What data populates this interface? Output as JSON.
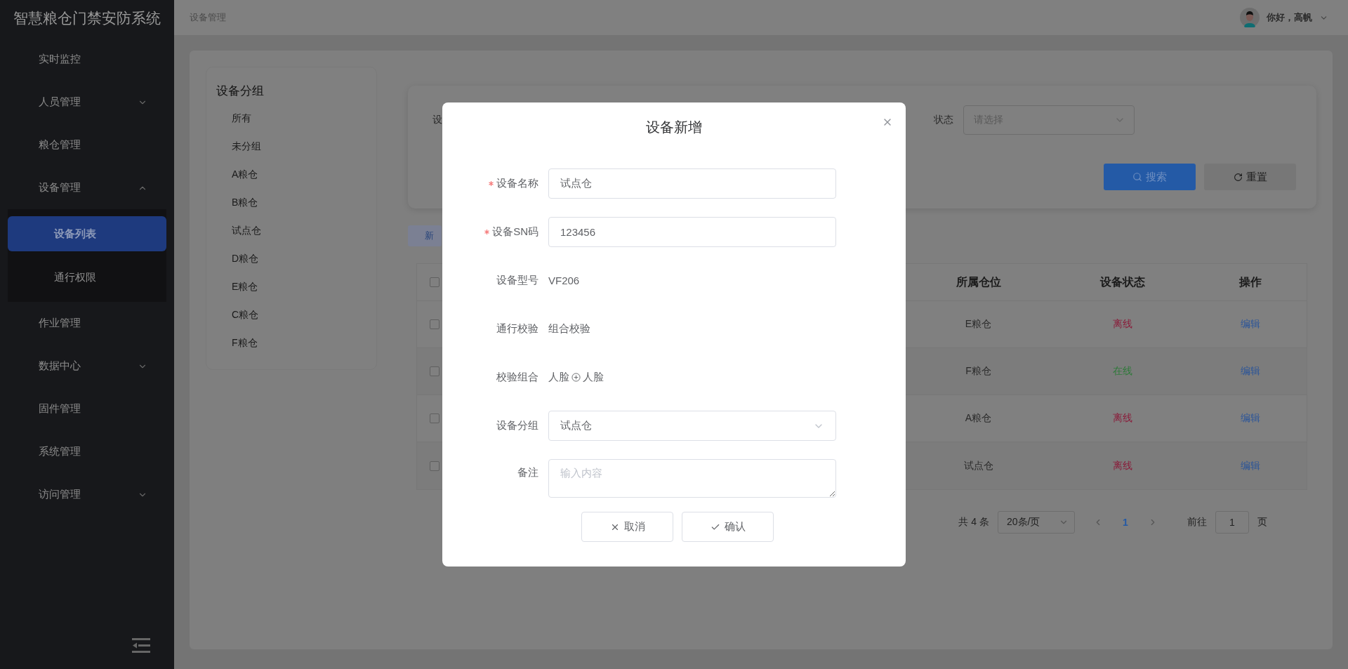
{
  "app_title": "智慧粮仓门禁安防系统",
  "sidebar": {
    "items": [
      {
        "kind": "link",
        "label": "实时监控",
        "selected": false
      },
      {
        "kind": "group",
        "label": "人员管理",
        "selected": false,
        "expanded": false
      },
      {
        "kind": "link",
        "label": "粮仓管理",
        "selected": false
      },
      {
        "kind": "group",
        "label": "设备管理",
        "selected": false,
        "expanded": true,
        "children": [
          {
            "label": "设备列表",
            "selected": true
          },
          {
            "label": "通行权限",
            "selected": false
          }
        ]
      },
      {
        "kind": "link",
        "label": "作业管理",
        "selected": false
      },
      {
        "kind": "group",
        "label": "数据中心",
        "selected": false,
        "expanded": false
      },
      {
        "kind": "link",
        "label": "固件管理",
        "selected": false
      },
      {
        "kind": "link",
        "label": "系统管理",
        "selected": false
      },
      {
        "kind": "group",
        "label": "访问管理",
        "selected": false,
        "expanded": false
      }
    ]
  },
  "header": {
    "breadcrumb": "设备管理",
    "greeting": "你好，高帆"
  },
  "group_panel": {
    "title": "设备分组",
    "items": [
      "所有",
      "未分组",
      "A粮仓",
      "B粮仓",
      "试点仓",
      "D粮仓",
      "E粮仓",
      "C粮仓",
      "F粮仓"
    ]
  },
  "filter": {
    "fields": [
      {
        "label": "设"
      },
      {
        "label": "状态",
        "placeholder": "请选择"
      }
    ],
    "buttons": [
      {
        "kind": "primary",
        "label": "搜索"
      },
      {
        "kind": "default",
        "label": "重置"
      }
    ]
  },
  "toolbar": {
    "add_button": "新"
  },
  "table": {
    "header_checked": false,
    "columns": [
      "所属仓位",
      "设备状态",
      "操作"
    ],
    "rows": [
      {
        "checked": false,
        "location": "E粮仓",
        "status": "离线",
        "online": false,
        "action": "编辑"
      },
      {
        "checked": false,
        "location": "F粮仓",
        "status": "在线",
        "online": true,
        "action": "编辑"
      },
      {
        "checked": false,
        "location": "A粮仓",
        "status": "离线",
        "online": false,
        "action": "编辑"
      },
      {
        "checked": false,
        "location": "试点仓",
        "status": "离线",
        "online": false,
        "action": "编辑"
      }
    ]
  },
  "pagination": {
    "total": "共 4 条",
    "page_size": "20条/页",
    "pages": [
      {
        "label": "1",
        "selected": true
      }
    ],
    "goto_label": "前往",
    "goto_value": "1",
    "goto_suffix": "页"
  },
  "dialog": {
    "title": "设备新增",
    "fields": [
      {
        "kind": "input",
        "label": "设备名称",
        "required": true,
        "value": "试点仓"
      },
      {
        "kind": "input",
        "label": "设备SN码",
        "required": true,
        "value": "123456"
      },
      {
        "kind": "text",
        "label": "设备型号",
        "required": false,
        "value": "VF206"
      },
      {
        "kind": "text",
        "label": "通行校验",
        "required": false,
        "value": "组合校验"
      },
      {
        "kind": "combo",
        "label": "校验组合",
        "required": false,
        "parts": [
          "人脸",
          "人脸"
        ]
      },
      {
        "kind": "select",
        "label": "设备分组",
        "required": false,
        "value": "试点仓"
      },
      {
        "kind": "textarea",
        "label": "备注",
        "required": false,
        "placeholder": "输入内容"
      }
    ],
    "buttons": [
      {
        "kind": "cancel",
        "label": "取消"
      },
      {
        "kind": "confirm",
        "label": "确认"
      }
    ]
  }
}
